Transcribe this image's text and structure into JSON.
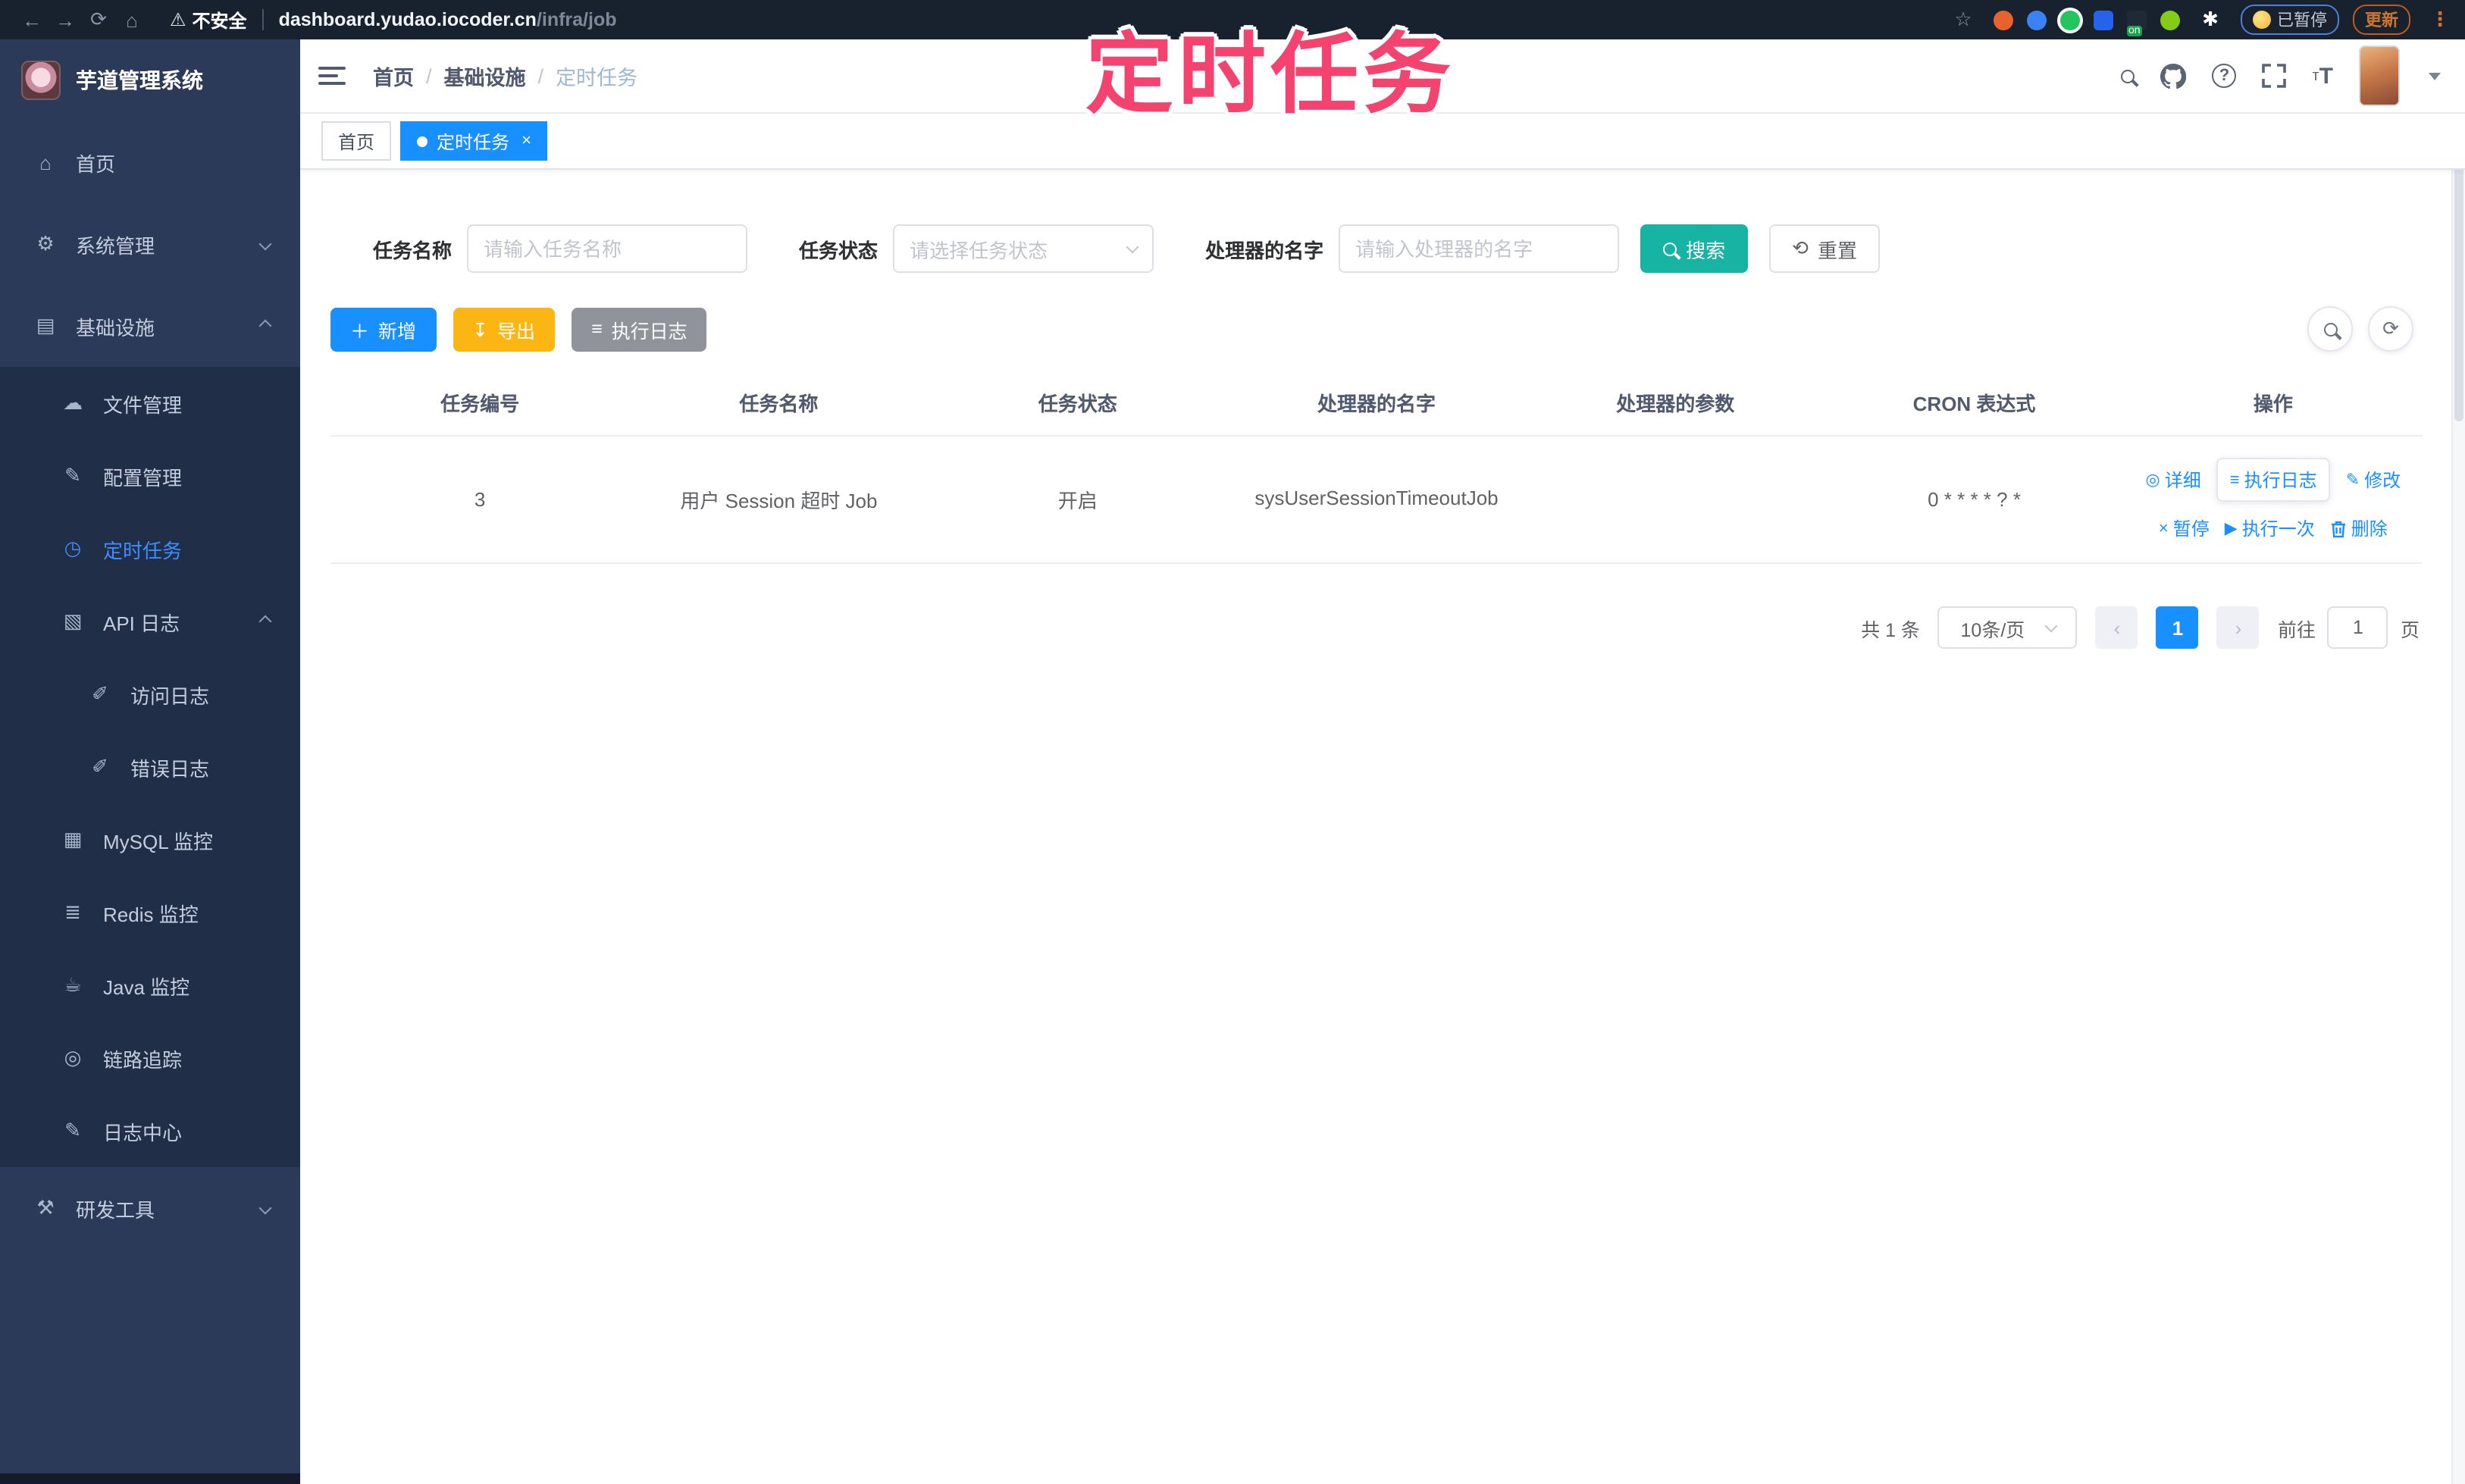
{
  "browser": {
    "security_label": "不安全",
    "url_host": "dashboard.yudao.iocoder.cn",
    "url_path": "/infra/job",
    "ext_on_badge": "on",
    "paused_badge": "已暂停",
    "update_button": "更新"
  },
  "overlay": {
    "title": "定时任务"
  },
  "sidebar": {
    "logo_title": "芋道管理系统",
    "items": [
      {
        "label": "首页"
      },
      {
        "label": "系统管理"
      },
      {
        "label": "基础设施"
      },
      {
        "label": "文件管理"
      },
      {
        "label": "配置管理"
      },
      {
        "label": "定时任务"
      },
      {
        "label": "API 日志"
      },
      {
        "label": "访问日志"
      },
      {
        "label": "错误日志"
      },
      {
        "label": "MySQL 监控"
      },
      {
        "label": "Redis 监控"
      },
      {
        "label": "Java 监控"
      },
      {
        "label": "链路追踪"
      },
      {
        "label": "日志中心"
      },
      {
        "label": "研发工具"
      }
    ]
  },
  "header": {
    "breadcrumb": [
      "首页",
      "基础设施",
      "定时任务"
    ]
  },
  "tags": {
    "home": "首页",
    "current": "定时任务"
  },
  "search": {
    "name_label": "任务名称",
    "name_placeholder": "请输入任务名称",
    "status_label": "任务状态",
    "status_placeholder": "请选择任务状态",
    "handler_label": "处理器的名字",
    "handler_placeholder": "请输入处理器的名字",
    "search_button": "搜索",
    "reset_button": "重置"
  },
  "toolbar": {
    "add": "新增",
    "export": "导出",
    "job_log": "执行日志"
  },
  "table": {
    "headers": [
      "任务编号",
      "任务名称",
      "任务状态",
      "处理器的名字",
      "处理器的参数",
      "CRON 表达式",
      "操作"
    ],
    "row": {
      "id": "3",
      "name": "用户 Session 超时 Job",
      "status": "开启",
      "handler": "sysUserSessionTimeoutJob",
      "param": "",
      "cron": "0 * * * * ? *",
      "action_detail": "详细",
      "action_job_log": "执行日志",
      "action_edit": "修改",
      "action_pause": "暂停",
      "action_run_once": "执行一次",
      "action_delete": "删除"
    }
  },
  "pagination": {
    "total": "共 1 条",
    "page_size": "10条/页",
    "current_page": "1",
    "goto_label": "前往",
    "goto_value": "1",
    "page_unit": "页"
  },
  "colors": {
    "accent": "#1890ff",
    "search_teal": "#17b3a3",
    "export_amber": "#fbb614",
    "info_gray": "#909399",
    "annotation_pink": "#f4436e",
    "sidebar_bg": "#2b3a58"
  }
}
